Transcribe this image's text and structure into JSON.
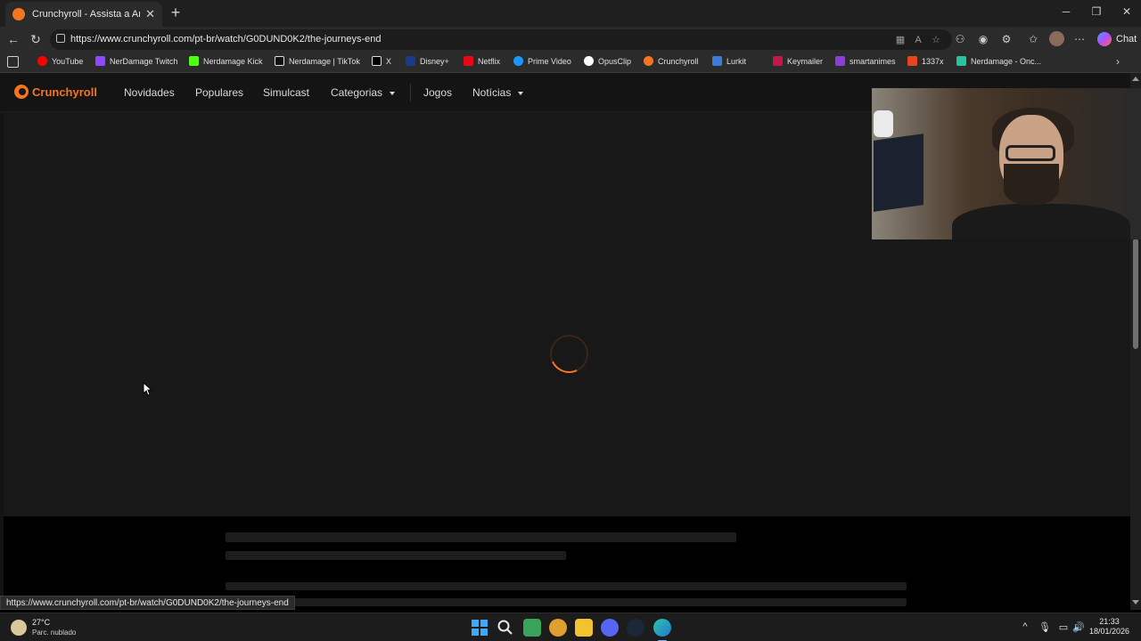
{
  "browser": {
    "tab_title": "Crunchyroll - Assista a Animes, Jog",
    "tab_close": "✕",
    "new_tab": "+",
    "url": "https://www.crunchyroll.com/pt-br/watch/G0DUND0K2/the-journeys-end",
    "copilot_label": "Chat",
    "status_url": "https://www.crunchyroll.com/pt-br/watch/G0DUND0K2/the-journeys-end"
  },
  "bookmarks": [
    {
      "label": "YouTube",
      "color": "#ff0000"
    },
    {
      "label": "NerDamage Twitch",
      "color": "#9146ff"
    },
    {
      "label": "Nerdamage Kick",
      "color": "#53fc18"
    },
    {
      "label": "Nerdamage | TikTok",
      "color": "#ffffff"
    },
    {
      "label": "X",
      "color": "#ffffff"
    },
    {
      "label": "Disney+",
      "color": "#1a3b8a"
    },
    {
      "label": "Netflix",
      "color": "#e50914"
    },
    {
      "label": "Prime Video",
      "color": "#1a98ff"
    },
    {
      "label": "OpusClip",
      "color": "#ffffff"
    },
    {
      "label": "Crunchyroll",
      "color": "#f47521"
    },
    {
      "label": "Lurkit",
      "color": "#3d7bd8"
    },
    {
      "label": "Keymailer",
      "color": "#c0184a"
    },
    {
      "label": "smartanimes",
      "color": "#8a3dd8"
    },
    {
      "label": "1337x",
      "color": "#e8441d"
    },
    {
      "label": "Nerdamage - Onc...",
      "color": "#27c2a0"
    }
  ],
  "site": {
    "brand": "Crunchyroll",
    "brand_color": "#f47521",
    "nav": [
      "Novidades",
      "Populares",
      "Simulcast",
      "Categorias",
      "Jogos",
      "Notícias"
    ]
  },
  "player": {
    "state": "loading",
    "spinner_color": "#f47521"
  },
  "taskbar": {
    "weather_temp": "27°C",
    "weather_desc": "Parc. nublado",
    "time": "21:33",
    "date": "18/01/2026",
    "apps": [
      "start-icon",
      "search-icon",
      "app-icon",
      "app-icon",
      "file-explorer-icon",
      "discord-icon",
      "steam-icon",
      "edge-icon"
    ]
  }
}
